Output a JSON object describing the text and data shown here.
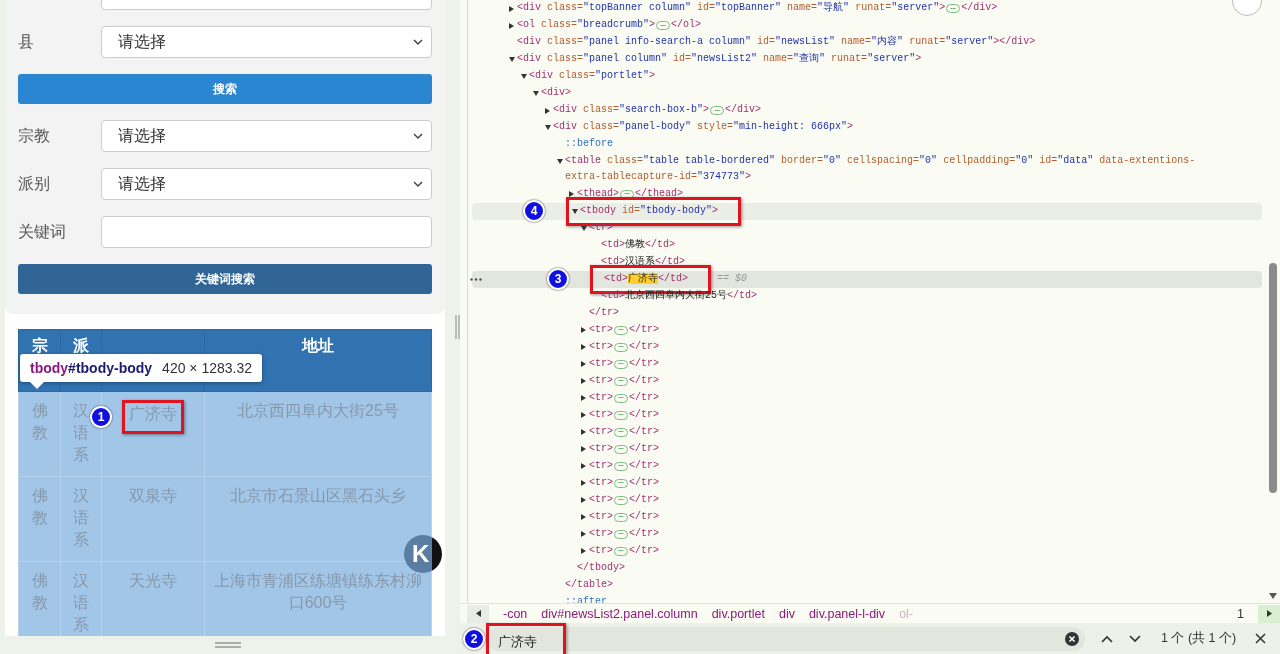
{
  "search_form": {
    "fields": [
      {
        "kind": "select"
      },
      {
        "kind": "select",
        "label": "县",
        "value": "请选择"
      },
      {
        "kind": "primary_button",
        "label": "搜索"
      },
      {
        "kind": "select",
        "label": "宗教",
        "value": "请选择"
      },
      {
        "kind": "select",
        "label": "派别",
        "value": "请选择"
      },
      {
        "kind": "input",
        "label": "关键词"
      },
      {
        "kind": "dark_button",
        "label": "关键词搜索"
      }
    ]
  },
  "results_table": {
    "columns": [
      {
        "label": "宗"
      },
      {
        "label": "派"
      },
      {},
      {
        "label": "地址"
      }
    ],
    "rows": [
      {
        "cells": [
          {
            "text": "佛教"
          },
          {
            "text": "汉语系"
          },
          {
            "text": "广济寺",
            "marker": "1"
          },
          {
            "text": "北京西四阜内大街25号"
          }
        ]
      },
      {
        "cells": [
          {
            "text": "佛教"
          },
          {
            "text": "汉语系"
          },
          {
            "text": "双泉寺"
          },
          {
            "text": "北京市石景山区黑石头乡"
          }
        ]
      },
      {
        "cells": [
          {
            "text": "佛教"
          },
          {
            "text": "汉语系"
          },
          {
            "text": "天光寺"
          },
          {
            "text": "上海市青浦区练塘镇练东村泖口600号"
          }
        ]
      }
    ]
  },
  "inspect_tooltip": {
    "tag": "tbody",
    "id": "#tbody-body",
    "size": "420 × 1283.32"
  },
  "floating_button": {
    "label": "K"
  },
  "elements_tree": [
    {
      "open": [
        {
          "kind": "tag",
          "text": "<div"
        },
        {
          "kind": "attr",
          "text": " class="
        },
        {
          "kind": "value",
          "text": "\"topBanner column\""
        },
        {
          "kind": "attr",
          "text": " id="
        },
        {
          "kind": "value",
          "text": "\"topBanner\""
        },
        {
          "kind": "attr",
          "text": " name="
        },
        {
          "kind": "value",
          "text": "\"导航\""
        },
        {
          "kind": "attr",
          "text": " runat="
        },
        {
          "kind": "value",
          "text": "\"server\""
        },
        {
          "kind": "tag",
          "text": ">"
        },
        {
          "kind": "ellipsis",
          "text": "⋯"
        },
        {
          "kind": "tag",
          "text": "</div>"
        }
      ],
      "expanded": false,
      "selected": false,
      "hovered": false
    },
    {
      "open": [
        {
          "kind": "tag",
          "text": "<ol"
        },
        {
          "kind": "attr",
          "text": " class="
        },
        {
          "kind": "value",
          "text": "\"breadcrumb\""
        },
        {
          "kind": "tag",
          "text": ">"
        },
        {
          "kind": "ellipsis",
          "text": "⋯"
        },
        {
          "kind": "tag",
          "text": "</ol>"
        }
      ],
      "expanded": false,
      "selected": false,
      "hovered": false
    },
    {
      "open": [
        {
          "kind": "tag",
          "text": "<div"
        },
        {
          "kind": "attr",
          "text": " class="
        },
        {
          "kind": "value",
          "text": "\"panel info-search-a column\""
        },
        {
          "kind": "attr",
          "text": " id="
        },
        {
          "kind": "value",
          "text": "\"newsList\""
        },
        {
          "kind": "attr",
          "text": " name="
        },
        {
          "kind": "value",
          "text": "\"内容\""
        },
        {
          "kind": "attr",
          "text": " runat="
        },
        {
          "kind": "value",
          "text": "\"server\""
        },
        {
          "kind": "tag",
          "text": "></div>"
        }
      ],
      "selected": false,
      "hovered": false
    },
    {
      "open": [
        {
          "kind": "tag",
          "text": "<div"
        },
        {
          "kind": "attr",
          "text": " class="
        },
        {
          "kind": "value",
          "text": "\"panel column\""
        },
        {
          "kind": "attr",
          "text": " id="
        },
        {
          "kind": "value",
          "text": "\"newsList2\""
        },
        {
          "kind": "attr",
          "text": " name="
        },
        {
          "kind": "value",
          "text": "\"查询\""
        },
        {
          "kind": "attr",
          "text": " runat="
        },
        {
          "kind": "value",
          "text": "\"server\""
        },
        {
          "kind": "tag",
          "text": ">"
        }
      ],
      "expanded": true,
      "selected": false,
      "hovered": false,
      "children": [
        {
          "open": [
            {
              "kind": "tag",
              "text": "<div"
            },
            {
              "kind": "attr",
              "text": " class="
            },
            {
              "kind": "value",
              "text": "\"portlet\""
            },
            {
              "kind": "tag",
              "text": ">"
            }
          ],
          "expanded": true,
          "selected": false,
          "hovered": false,
          "children": [
            {
              "open": [
                {
                  "kind": "tag",
                  "text": "<div>"
                }
              ],
              "expanded": true,
              "selected": false,
              "hovered": false,
              "children": [
                {
                  "open": [
                    {
                      "kind": "tag",
                      "text": "<div"
                    },
                    {
                      "kind": "attr",
                      "text": " class="
                    },
                    {
                      "kind": "value",
                      "text": "\"search-box-b\""
                    },
                    {
                      "kind": "tag",
                      "text": ">"
                    },
                    {
                      "kind": "ellipsis",
                      "text": "⋯"
                    },
                    {
                      "kind": "tag",
                      "text": "</div>"
                    }
                  ],
                  "expanded": false,
                  "selected": false,
                  "hovered": false
                },
                {
                  "open": [
                    {
                      "kind": "tag",
                      "text": "<div"
                    },
                    {
                      "kind": "attr",
                      "text": " class="
                    },
                    {
                      "kind": "value",
                      "text": "\"panel-body\""
                    },
                    {
                      "kind": "attr",
                      "text": " style="
                    },
                    {
                      "kind": "value",
                      "text": "\"min-height: 666px\""
                    },
                    {
                      "kind": "tag",
                      "text": ">"
                    }
                  ],
                  "expanded": true,
                  "selected": false,
                  "hovered": false,
                  "children": [
                    {
                      "open": [
                        {
                          "kind": "pseudo",
                          "text": "::before"
                        }
                      ],
                      "selected": false,
                      "hovered": false
                    },
                    {
                      "open": [
                        {
                          "kind": "tag",
                          "text": "<table"
                        },
                        {
                          "kind": "attr",
                          "text": " class="
                        },
                        {
                          "kind": "value",
                          "text": "\"table table-bordered\""
                        },
                        {
                          "kind": "attr",
                          "text": " border="
                        },
                        {
                          "kind": "value",
                          "text": "\"0\""
                        },
                        {
                          "kind": "attr",
                          "text": " cellspacing="
                        },
                        {
                          "kind": "value",
                          "text": "\"0\""
                        },
                        {
                          "kind": "attr",
                          "text": " cellpadding="
                        },
                        {
                          "kind": "value",
                          "text": "\"0\""
                        },
                        {
                          "kind": "attr",
                          "text": " id="
                        },
                        {
                          "kind": "value",
                          "text": "\"data\""
                        },
                        {
                          "kind": "attr",
                          "text": " data-extentions-extra-tablecapture-id="
                        },
                        {
                          "kind": "value",
                          "text": "\"374773\""
                        },
                        {
                          "kind": "tag",
                          "text": ">"
                        }
                      ],
                      "expanded": true,
                      "selected": false,
                      "hovered": false,
                      "close": [
                        {
                          "kind": "tag",
                          "text": "</table>"
                        }
                      ],
                      "children": [
                        {
                          "open": [
                            {
                              "kind": "tag",
                              "text": "<thead>"
                            },
                            {
                              "kind": "ellipsis",
                              "text": "⋯"
                            },
                            {
                              "kind": "tag",
                              "text": "</thead>"
                            }
                          ],
                          "expanded": false,
                          "selected": false,
                          "hovered": false
                        },
                        {
                          "open": [
                            {
                              "kind": "tag",
                              "text": "<tbody"
                            },
                            {
                              "kind": "attr",
                              "text": " id="
                            },
                            {
                              "kind": "value",
                              "text": "\"tbody-body\""
                            },
                            {
                              "kind": "tag",
                              "text": ">"
                            }
                          ],
                          "expanded": true,
                          "selected": false,
                          "hovered": true,
                          "marker": "4",
                          "close": [
                            {
                              "kind": "tag",
                              "text": "</tbody>"
                            }
                          ],
                          "children": [
                            {
                              "open": [
                                {
                                  "kind": "tag",
                                  "text": "<tr>"
                                }
                              ],
                              "expanded": true,
                              "selected": false,
                              "hovered": false,
                              "close": [
                                {
                                  "kind": "tag",
                                  "text": "</tr>"
                                }
                              ],
                              "children": [
                                {
                                  "open": [
                                    {
                                      "kind": "tag",
                                      "text": "<td>"
                                    },
                                    {
                                      "kind": "text",
                                      "text": "佛教"
                                    },
                                    {
                                      "kind": "tag",
                                      "text": "</td>"
                                    }
                                  ],
                                  "selected": false,
                                  "hovered": false
                                },
                                {
                                  "open": [
                                    {
                                      "kind": "tag",
                                      "text": "<td>"
                                    },
                                    {
                                      "kind": "text",
                                      "text": "汉语系"
                                    },
                                    {
                                      "kind": "tag",
                                      "text": "</td>"
                                    }
                                  ],
                                  "selected": false,
                                  "hovered": false
                                },
                                {
                                  "open": [
                                    {
                                      "kind": "tag",
                                      "text": "<td>"
                                    },
                                    {
                                      "kind": "match",
                                      "text": "广济寺"
                                    },
                                    {
                                      "kind": "tag",
                                      "text": "</td>"
                                    },
                                    {
                                      "kind": "hint",
                                      "text": "== $0"
                                    }
                                  ],
                                  "selected": true,
                                  "hovered": false,
                                  "marker": "3"
                                },
                                {
                                  "open": [
                                    {
                                      "kind": "tag",
                                      "text": "<td>"
                                    },
                                    {
                                      "kind": "text",
                                      "text": "北京西四阜内大街25号"
                                    },
                                    {
                                      "kind": "tag",
                                      "text": "</td>"
                                    }
                                  ],
                                  "selected": false,
                                  "hovered": false
                                }
                              ]
                            },
                            {
                              "open": [
                                {
                                  "kind": "tag",
                                  "text": "<tr>"
                                },
                                {
                                  "kind": "ellipsis",
                                  "text": "⋯"
                                },
                                {
                                  "kind": "tag",
                                  "text": "</tr>"
                                }
                              ],
                              "expanded": false,
                              "selected": false,
                              "hovered": false
                            },
                            {
                              "open": [
                                {
                                  "kind": "tag",
                                  "text": "<tr>"
                                },
                                {
                                  "kind": "ellipsis",
                                  "text": "⋯"
                                },
                                {
                                  "kind": "tag",
                                  "text": "</tr>"
                                }
                              ],
                              "expanded": false,
                              "selected": false,
                              "hovered": false
                            },
                            {
                              "open": [
                                {
                                  "kind": "tag",
                                  "text": "<tr>"
                                },
                                {
                                  "kind": "ellipsis",
                                  "text": "⋯"
                                },
                                {
                                  "kind": "tag",
                                  "text": "</tr>"
                                }
                              ],
                              "expanded": false,
                              "selected": false,
                              "hovered": false
                            },
                            {
                              "open": [
                                {
                                  "kind": "tag",
                                  "text": "<tr>"
                                },
                                {
                                  "kind": "ellipsis",
                                  "text": "⋯"
                                },
                                {
                                  "kind": "tag",
                                  "text": "</tr>"
                                }
                              ],
                              "expanded": false,
                              "selected": false,
                              "hovered": false
                            },
                            {
                              "open": [
                                {
                                  "kind": "tag",
                                  "text": "<tr>"
                                },
                                {
                                  "kind": "ellipsis",
                                  "text": "⋯"
                                },
                                {
                                  "kind": "tag",
                                  "text": "</tr>"
                                }
                              ],
                              "expanded": false,
                              "selected": false,
                              "hovered": false
                            },
                            {
                              "open": [
                                {
                                  "kind": "tag",
                                  "text": "<tr>"
                                },
                                {
                                  "kind": "ellipsis",
                                  "text": "⋯"
                                },
                                {
                                  "kind": "tag",
                                  "text": "</tr>"
                                }
                              ],
                              "expanded": false,
                              "selected": false,
                              "hovered": false
                            },
                            {
                              "open": [
                                {
                                  "kind": "tag",
                                  "text": "<tr>"
                                },
                                {
                                  "kind": "ellipsis",
                                  "text": "⋯"
                                },
                                {
                                  "kind": "tag",
                                  "text": "</tr>"
                                }
                              ],
                              "expanded": false,
                              "selected": false,
                              "hovered": false
                            },
                            {
                              "open": [
                                {
                                  "kind": "tag",
                                  "text": "<tr>"
                                },
                                {
                                  "kind": "ellipsis",
                                  "text": "⋯"
                                },
                                {
                                  "kind": "tag",
                                  "text": "</tr>"
                                }
                              ],
                              "expanded": false,
                              "selected": false,
                              "hovered": false
                            },
                            {
                              "open": [
                                {
                                  "kind": "tag",
                                  "text": "<tr>"
                                },
                                {
                                  "kind": "ellipsis",
                                  "text": "⋯"
                                },
                                {
                                  "kind": "tag",
                                  "text": "</tr>"
                                }
                              ],
                              "expanded": false,
                              "selected": false,
                              "hovered": false
                            },
                            {
                              "open": [
                                {
                                  "kind": "tag",
                                  "text": "<tr>"
                                },
                                {
                                  "kind": "ellipsis",
                                  "text": "⋯"
                                },
                                {
                                  "kind": "tag",
                                  "text": "</tr>"
                                }
                              ],
                              "expanded": false,
                              "selected": false,
                              "hovered": false
                            },
                            {
                              "open": [
                                {
                                  "kind": "tag",
                                  "text": "<tr>"
                                },
                                {
                                  "kind": "ellipsis",
                                  "text": "⋯"
                                },
                                {
                                  "kind": "tag",
                                  "text": "</tr>"
                                }
                              ],
                              "expanded": false,
                              "selected": false,
                              "hovered": false
                            },
                            {
                              "open": [
                                {
                                  "kind": "tag",
                                  "text": "<tr>"
                                },
                                {
                                  "kind": "ellipsis",
                                  "text": "⋯"
                                },
                                {
                                  "kind": "tag",
                                  "text": "</tr>"
                                }
                              ],
                              "expanded": false,
                              "selected": false,
                              "hovered": false
                            },
                            {
                              "open": [
                                {
                                  "kind": "tag",
                                  "text": "<tr>"
                                },
                                {
                                  "kind": "ellipsis",
                                  "text": "⋯"
                                },
                                {
                                  "kind": "tag",
                                  "text": "</tr>"
                                }
                              ],
                              "expanded": false,
                              "selected": false,
                              "hovered": false
                            },
                            {
                              "open": [
                                {
                                  "kind": "tag",
                                  "text": "<tr>"
                                },
                                {
                                  "kind": "ellipsis",
                                  "text": "⋯"
                                },
                                {
                                  "kind": "tag",
                                  "text": "</tr>"
                                }
                              ],
                              "expanded": false,
                              "selected": false,
                              "hovered": false
                            }
                          ]
                        }
                      ]
                    },
                    {
                      "open": [
                        {
                          "kind": "pseudo",
                          "text": "::after"
                        }
                      ],
                      "selected": false,
                      "hovered": false
                    }
                  ]
                }
              ]
            }
          ]
        }
      ]
    }
  ],
  "breadcrumb_bar": {
    "items": [
      {
        "text": "-con",
        "faded": false
      },
      {
        "text": "div#newsList2.panel.column",
        "faded": false
      },
      {
        "text": "div.portlet",
        "faded": false
      },
      {
        "text": "div",
        "faded": false
      },
      {
        "text": "div.panel-l-div",
        "faded": false
      },
      {
        "text": "ol-",
        "faded": true
      }
    ],
    "overflow_text": "1"
  },
  "find_bar": {
    "query": "广济寺",
    "marker": "2",
    "result": "1 个 (共 1 个)"
  }
}
